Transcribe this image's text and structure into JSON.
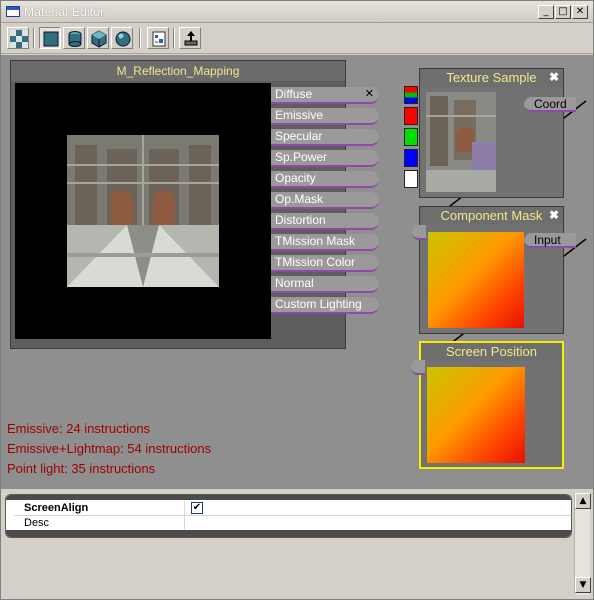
{
  "window": {
    "title": "Material Editor"
  },
  "titlebar_buttons": {
    "minimize": "_",
    "maximize": "□",
    "close": "✕"
  },
  "toolbar": {
    "tools": [
      "checker-background-icon",
      "plane-preview-icon",
      "cylinder-preview-icon",
      "cube-preview-icon",
      "sphere-preview-icon",
      "apply-material-icon",
      "home-view-icon"
    ]
  },
  "material_node": {
    "title": "M_Reflection_Mapping",
    "inputs": [
      "Diffuse",
      "Emissive",
      "Specular",
      "Sp.Power",
      "Opacity",
      "Op.Mask",
      "Distortion",
      "TMission Mask",
      "TMission Color",
      "Normal",
      "Custom Lighting"
    ],
    "close": "✕"
  },
  "channel_colors": [
    "#000000",
    "#ff0000",
    "#00e000",
    "#0000ff",
    "#ffffff"
  ],
  "nodes": {
    "texture_sample": {
      "title": "Texture Sample",
      "output": "Coord",
      "close": "✖"
    },
    "component_mask": {
      "title": "Component Mask",
      "output": "Input",
      "close": "✖"
    },
    "screen_position": {
      "title": "Screen Position"
    }
  },
  "stats": [
    "Emissive: 24 instructions",
    "Emissive+Lightmap: 54 instructions",
    "Point light: 35 instructions"
  ],
  "properties": [
    {
      "name": "ScreenAlign",
      "value": "✔"
    },
    {
      "name": "Desc",
      "value": ""
    }
  ],
  "scroll": {
    "up": "▲",
    "down": "▼"
  },
  "colors": {
    "accent_title": "#f0e88c",
    "stats_text": "#9c0000",
    "selected_border": "#f4f000"
  }
}
